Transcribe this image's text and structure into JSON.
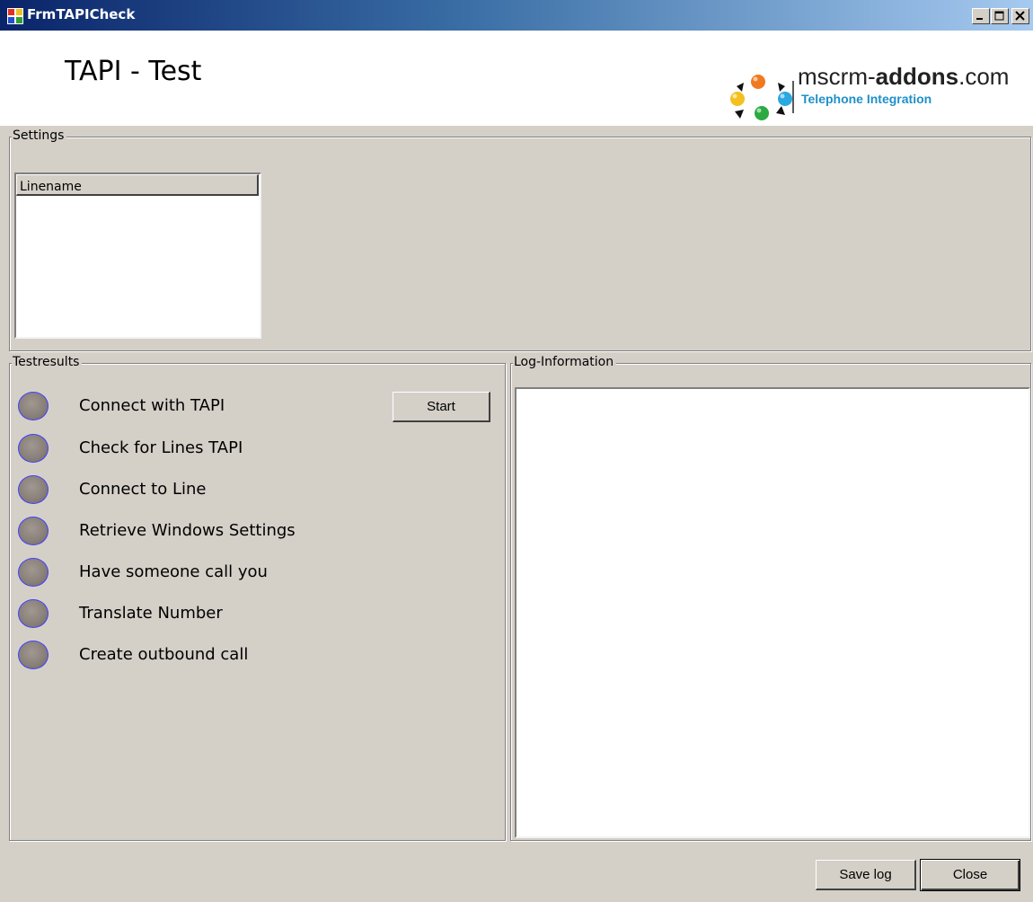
{
  "window": {
    "title": "FrmTAPICheck",
    "controls": [
      "minimize-icon",
      "maximize-icon",
      "close-icon"
    ]
  },
  "header": {
    "title": "TAPI - Test",
    "logo": {
      "text_prefix": "mscrm-",
      "text_bold": "addons",
      "text_suffix": ".com",
      "subtitle": "Telephone Integration"
    }
  },
  "settings": {
    "group_label": "Settings",
    "list": {
      "columns": [
        "Linename"
      ],
      "rows": []
    }
  },
  "testresults": {
    "group_label": "Testresults",
    "start_label": "Start",
    "items": [
      {
        "label": "Connect with TAPI",
        "status": "idle"
      },
      {
        "label": "Check for Lines TAPI",
        "status": "idle"
      },
      {
        "label": "Connect to Line",
        "status": "idle"
      },
      {
        "label": "Retrieve Windows Settings",
        "status": "idle"
      },
      {
        "label": "Have someone call you",
        "status": "idle"
      },
      {
        "label": "Translate Number",
        "status": "idle"
      },
      {
        "label": "Create outbound call",
        "status": "idle"
      }
    ]
  },
  "log": {
    "group_label": "Log-Information",
    "content": ""
  },
  "footer": {
    "save_log_label": "Save log",
    "close_label": "Close"
  },
  "colors": {
    "titlebar_start": "#0a246a",
    "titlebar_end": "#a6caf0",
    "face": "#d4d0c8",
    "led_idle": "#8a817a",
    "led_outline": "#4040ff",
    "logo_subtitle": "#1e90c8"
  }
}
